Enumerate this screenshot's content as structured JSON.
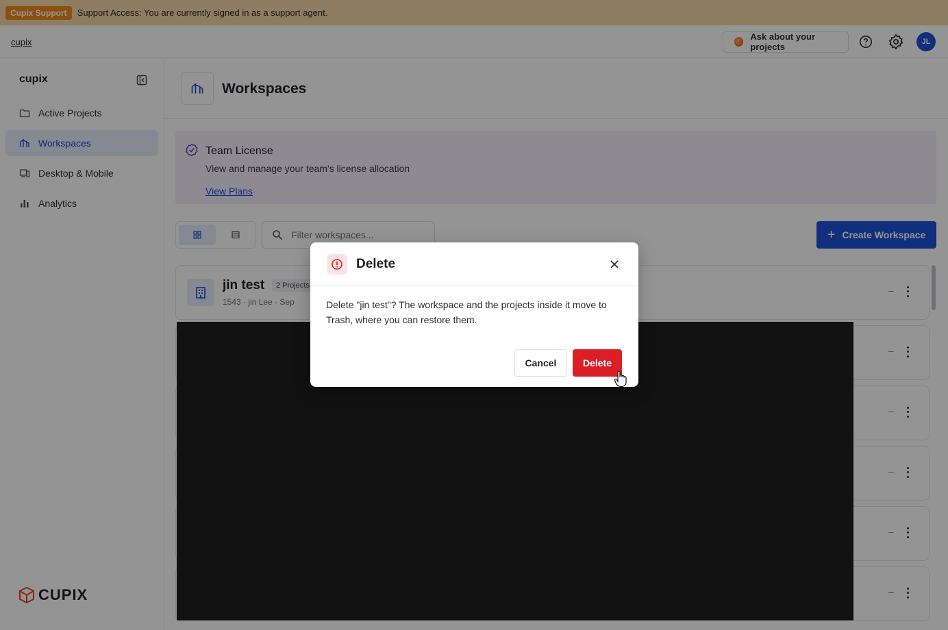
{
  "support_banner": {
    "badge": "Cupix Support",
    "message": "Support Access: You are currently signed in as a support agent."
  },
  "header": {
    "breadcrumb": "cupix",
    "ask_label": "Ask about your projects",
    "avatar_initials": "JL"
  },
  "sidebar": {
    "brand": "cupix",
    "items": [
      {
        "label": "Active Projects",
        "icon": "folder-icon",
        "active": false
      },
      {
        "label": "Workspaces",
        "icon": "workspaces-icon",
        "active": true
      },
      {
        "label": "Desktop & Mobile",
        "icon": "devices-icon",
        "active": false
      },
      {
        "label": "Analytics",
        "icon": "bar-chart-icon",
        "active": false
      }
    ],
    "logo_text": "CUPIX"
  },
  "main": {
    "title": "Workspaces",
    "license": {
      "title": "Team License",
      "description": "View and manage your team's license allocation",
      "link": "View Plans"
    },
    "filter_placeholder": "Filter workspaces...",
    "create_label": "Create Workspace",
    "workspace": {
      "name": "jin test",
      "projects": "2 Projects",
      "meta": "1543 · jin Lee · Sep"
    },
    "row_dash": "–"
  },
  "dialog": {
    "title": "Delete",
    "message": "Delete \"jin test\"? The workspace and the projects inside it move to Trash, where you can restore them.",
    "cancel_label": "Cancel",
    "delete_label": "Delete"
  },
  "colors": {
    "accent": "#1c52d6",
    "danger": "#dc1f26",
    "support": "#f08b1d",
    "license_bg": "#f3eefc"
  }
}
